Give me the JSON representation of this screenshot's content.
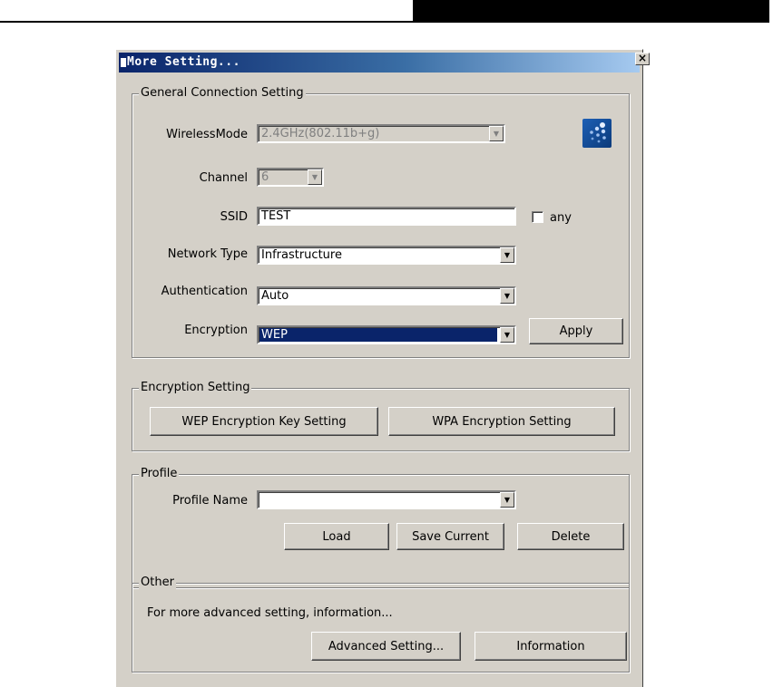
{
  "window": {
    "title": "More Setting..."
  },
  "general": {
    "legend": "General Connection Setting",
    "wireless_mode": {
      "label": "WirelessMode",
      "value": "2.4GHz(802.11b+g)"
    },
    "channel": {
      "label": "Channel",
      "value": "6"
    },
    "ssid": {
      "label": "SSID",
      "value": "TEST",
      "any_label": "any"
    },
    "network_type": {
      "label": "Network Type",
      "value": "Infrastructure"
    },
    "authentication": {
      "label": "Authentication",
      "value": "Auto"
    },
    "encryption": {
      "label": "Encryption",
      "value": "WEP"
    },
    "apply_label": "Apply"
  },
  "encryption_setting": {
    "legend": "Encryption Setting",
    "wep_button": "WEP Encryption Key Setting",
    "wpa_button": "WPA Encryption Setting"
  },
  "profile": {
    "legend": "Profile",
    "name_label": "Profile Name",
    "name_value": "",
    "load_label": "Load",
    "save_label": "Save Current",
    "delete_label": "Delete"
  },
  "other": {
    "legend": "Other",
    "description": "For more advanced setting, information...",
    "advanced_label": "Advanced Setting...",
    "information_label": "Information"
  },
  "colors": {
    "title_start": "#0a246a",
    "title_end": "#a6caf0",
    "dialog_bg": "#d4d0c8",
    "selection": "#0a246a"
  },
  "icons": {
    "close": "close-icon",
    "dropdown": "chevron-down-icon",
    "wireless": "wireless-icon"
  }
}
